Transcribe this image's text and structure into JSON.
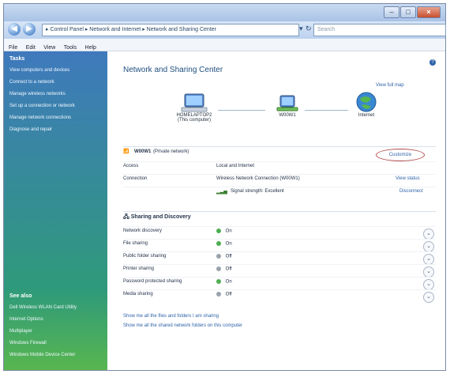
{
  "window": {
    "title": ""
  },
  "nav": {
    "back": "◀",
    "forward": "▶",
    "search_placeholder": "Search",
    "address": "▸ Control Panel ▸ Network and Internet ▸ Network and Sharing Center",
    "dropdown": "▾",
    "refresh": "↻"
  },
  "menu": [
    "File",
    "Edit",
    "View",
    "Tools",
    "Help"
  ],
  "sidebar": {
    "tasks_title": "Tasks",
    "items": [
      "View computers and devices",
      "Connect to a network",
      "Manage wireless networks",
      "Set up a connection or network",
      "Manage network connections",
      "Diagnose and repair"
    ],
    "see_also_title": "See also",
    "see_also_items": [
      "Dell Wireless WLAN Card Utility",
      "Internet Options",
      "Multiplayer",
      "Windows Firewall",
      "Windows Mobile Device Center"
    ]
  },
  "main": {
    "title": "Network and Sharing Center",
    "view_full_map": "View full map",
    "nodes": [
      {
        "name": "HOMELAPTOP2",
        "sub": "(This computer)"
      },
      {
        "name": "W00W1",
        "sub": ""
      },
      {
        "name": "Internet",
        "sub": ""
      }
    ],
    "network": {
      "name": "W00W1",
      "type": "(Private network)",
      "customize": "Customize",
      "rows": [
        {
          "label": "Access",
          "value": "Local and Internet",
          "action": ""
        },
        {
          "label": "Connection",
          "value": "Wireless Network Connection (W00W1)",
          "action": "View status"
        },
        {
          "label": "",
          "value": "Signal strength: Excellent",
          "action": "Disconnect"
        }
      ]
    },
    "sharing": {
      "title": "Sharing and Discovery",
      "rows": [
        {
          "label": "Network discovery",
          "state": "On",
          "color": "#4caf50"
        },
        {
          "label": "File sharing",
          "state": "On",
          "color": "#4caf50"
        },
        {
          "label": "Public folder sharing",
          "state": "Off",
          "color": "#9aa3ad"
        },
        {
          "label": "Printer sharing",
          "state": "Off",
          "color": "#9aa3ad"
        },
        {
          "label": "Password protected sharing",
          "state": "On",
          "color": "#4caf50"
        },
        {
          "label": "Media sharing",
          "state": "Off",
          "color": "#9aa3ad"
        }
      ]
    },
    "footer": [
      "Show me all the files and folders I am sharing",
      "Show me all the shared network folders on this computer"
    ]
  }
}
